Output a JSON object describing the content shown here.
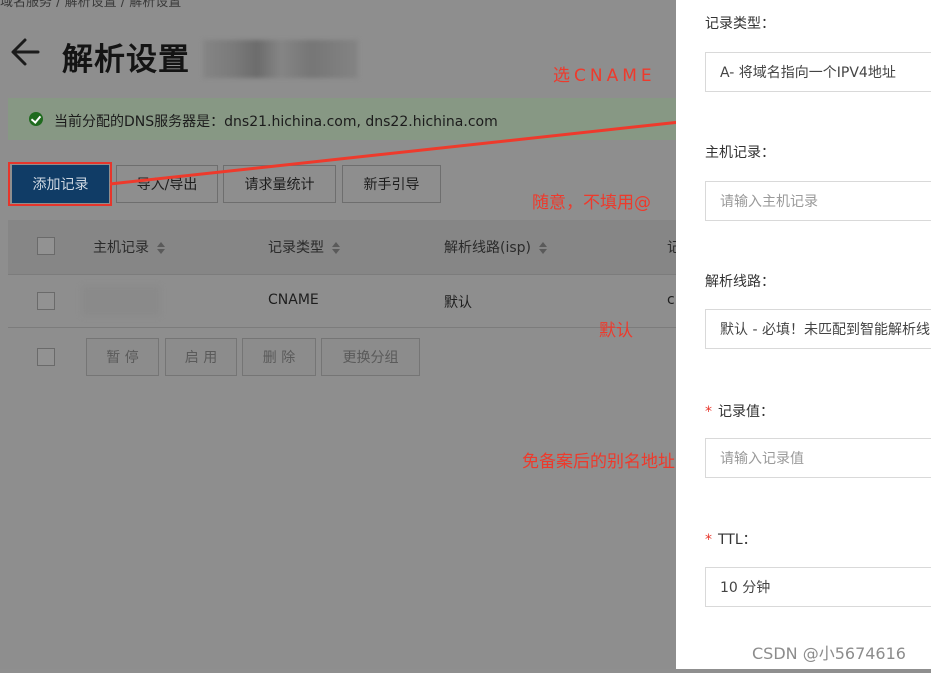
{
  "breadcrumb": "域名服务 / 解析设置 / 解析设置",
  "page_title": "解析设置",
  "dns_notice": "当前分配的DNS服务器是：dns21.hichina.com, dns22.hichina.com",
  "toolbar": {
    "add_label": "添加记录",
    "io_label": "导入/导出",
    "stats_label": "请求量统计",
    "guide_label": "新手引导"
  },
  "table": {
    "headers": [
      "主机记录",
      "记录类型",
      "解析线路(isp)",
      "记"
    ],
    "rows": [
      {
        "type": "CNAME",
        "line": "默认",
        "value": "c"
      }
    ]
  },
  "batch": {
    "pause_label": "暂 停",
    "enable_label": "启 用",
    "delete_label": "删 除",
    "group_label": "更换分组"
  },
  "annotations": {
    "cname": "选CNAME",
    "host": "随意，不填用@",
    "default": "默认",
    "alias": "免备案后的别名地址"
  },
  "drawer": {
    "type_label": "记录类型：",
    "type_value": "A- 将域名指向一个IPV4地址",
    "host_label": "主机记录：",
    "host_placeholder": "请输入主机记录",
    "line_label": "解析线路：",
    "line_value": "默认 - 必填！未匹配到智能解析线",
    "value_label": "记录值：",
    "value_placeholder": "请输入记录值",
    "ttl_label": "TTL：",
    "ttl_value": "10 分钟",
    "required_mark": "*"
  },
  "watermark": "CSDN @小5674616",
  "colors": {
    "primary": "#103c66",
    "annotation": "#ee3a2c",
    "required": "#e8362b",
    "success": "#1f6a1e"
  },
  "icons": [
    "back-arrow-icon",
    "check-circle-icon",
    "sort-icon",
    "annotation-arrow-icon"
  ]
}
